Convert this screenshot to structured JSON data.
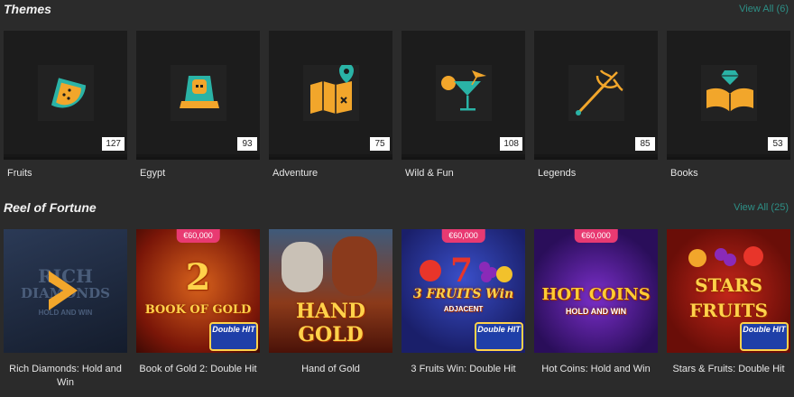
{
  "themes": {
    "title": "Themes",
    "view_all": "View All (6)",
    "items": [
      {
        "label": "Fruits",
        "count": "127",
        "icon": "watermelon-slice-icon"
      },
      {
        "label": "Egypt",
        "count": "93",
        "icon": "sphinx-icon"
      },
      {
        "label": "Adventure",
        "count": "75",
        "icon": "treasure-map-icon"
      },
      {
        "label": "Wild & Fun",
        "count": "108",
        "icon": "cocktail-icon"
      },
      {
        "label": "Legends",
        "count": "85",
        "icon": "trident-icon"
      },
      {
        "label": "Books",
        "count": "53",
        "icon": "open-book-gem-icon"
      }
    ],
    "icon_color": "#f2a62b",
    "icon_accent": "#2ab3a6"
  },
  "reel": {
    "title": "Reel of Fortune",
    "view_all": "View All (25)",
    "games": [
      {
        "label": "Rich Diamonds: Hold and Win",
        "prize": "",
        "art_line1": "RICH",
        "art_line2": "DIAMONDS",
        "art_line3": "HOLD AND WIN",
        "badge": ""
      },
      {
        "label": "Book of Gold 2: Double Hit",
        "prize": "€60,000",
        "art_line1": "2",
        "art_line2": "BOOK OF GOLD",
        "art_line3": "",
        "badge": "Double HIT"
      },
      {
        "label": "Hand of Gold",
        "prize": "",
        "art_line1": "HAND",
        "art_line2": "GOLD",
        "art_line3": "",
        "badge": ""
      },
      {
        "label": "3 Fruits Win: Double Hit",
        "prize": "€60,000",
        "art_line1": "3 FRUITS Win",
        "art_line2": "ADJACENT",
        "art_line3": "",
        "badge": "Double HIT"
      },
      {
        "label": "Hot Coins: Hold and Win",
        "prize": "€60,000",
        "art_line1": "HOT COINS",
        "art_line2": "HOLD AND WIN",
        "art_line3": "",
        "badge": ""
      },
      {
        "label": "Stars & Fruits: Double Hit",
        "prize": "",
        "art_line1": "STARS",
        "art_line2": "FRUITS",
        "art_line3": "",
        "badge": "Double HIT"
      }
    ]
  },
  "colors": {
    "background": "#2b2b2b",
    "card": "#1c1c1c",
    "link": "#2d8f86",
    "prize": "#e83a72"
  }
}
